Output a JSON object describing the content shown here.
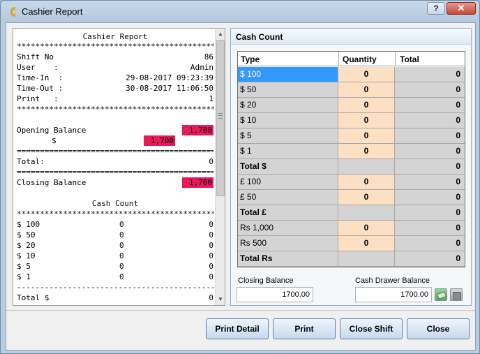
{
  "window": {
    "title": "Cashier Report",
    "help_label": "?",
    "close_label": "✕"
  },
  "receipt": {
    "title": "Cashier Report",
    "stars": "**********************************************",
    "equals": "================================================",
    "dashes": "------------------------------------------------",
    "shift_no_label": "Shift No",
    "shift_no": "86",
    "user_label": "User    :",
    "user": "Admin",
    "time_in_label": "Time-In  :",
    "time_in": "29-08-2017 09:23:39",
    "time_out_label": "Time-Out :",
    "time_out": "30-08-2017 11:06:50",
    "print_label": "Print   :",
    "print": "1",
    "opening_label": "Opening Balance",
    "opening_value": "1,700",
    "currency_symbol": "$",
    "currency_value": "1,700",
    "total_label": "Total:",
    "total_value": "0",
    "closing_label": "Closing Balance",
    "closing_value": "1,700",
    "cash_count_title": "Cash Count",
    "count_rows": [
      {
        "denom": "$ 100",
        "qty": "0",
        "total": "0"
      },
      {
        "denom": "$ 50",
        "qty": "0",
        "total": "0"
      },
      {
        "denom": "$ 20",
        "qty": "0",
        "total": "0"
      },
      {
        "denom": "$ 10",
        "qty": "0",
        "total": "0"
      },
      {
        "denom": "$ 5",
        "qty": "0",
        "total": "0"
      },
      {
        "denom": "$ 1",
        "qty": "0",
        "total": "0"
      }
    ],
    "total_dollar_label": "Total $",
    "total_dollar_value": "0"
  },
  "cash_count": {
    "header": "Cash Count",
    "columns": {
      "type": "Type",
      "quantity": "Quantity",
      "total": "Total"
    },
    "rows": [
      {
        "type": "$ 100",
        "qty": "0",
        "total": "0"
      },
      {
        "type": "$ 50",
        "qty": "0",
        "total": "0"
      },
      {
        "type": "$ 20",
        "qty": "0",
        "total": "0"
      },
      {
        "type": "$ 10",
        "qty": "0",
        "total": "0"
      },
      {
        "type": "$ 5",
        "qty": "0",
        "total": "0"
      },
      {
        "type": "$ 1",
        "qty": "0",
        "total": "0"
      },
      {
        "type": "Total $",
        "qty": "",
        "total": "0"
      },
      {
        "type": "£ 100",
        "qty": "0",
        "total": "0"
      },
      {
        "type": "£ 50",
        "qty": "0",
        "total": "0"
      },
      {
        "type": "Total £",
        "qty": "",
        "total": "0"
      },
      {
        "type": "Rs 1,000",
        "qty": "0",
        "total": "0"
      },
      {
        "type": "Rs 500",
        "qty": "0",
        "total": "0"
      },
      {
        "type": "Total Rs",
        "qty": "",
        "total": "0"
      }
    ],
    "closing_balance_label": "Closing Balance",
    "closing_balance_value": "1700.00",
    "drawer_balance_label": "Cash Drawer Balance",
    "drawer_balance_value": "1700.00"
  },
  "buttons": {
    "print_detail": "Print Detail",
    "print": "Print",
    "close_shift": "Close Shift",
    "close": "Close"
  },
  "colors": {
    "highlight": "#e8195a",
    "selected_row": "#3399ff",
    "quantity_cell": "#fde0c4"
  }
}
